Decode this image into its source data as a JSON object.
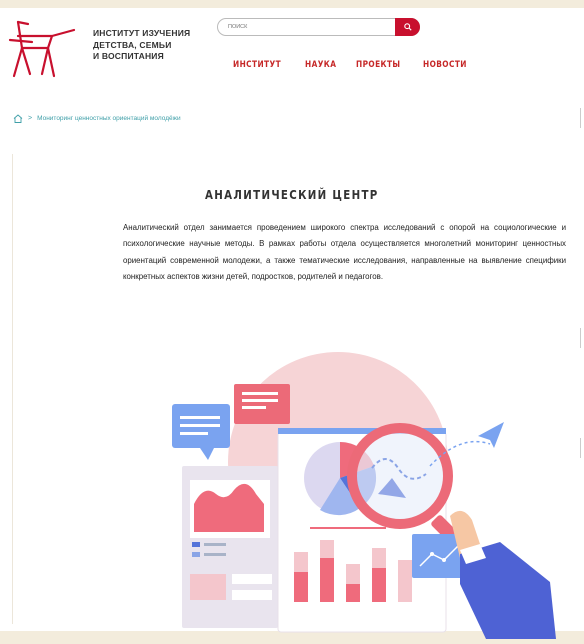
{
  "header": {
    "org_line1": "ИНСТИТУТ ИЗУЧЕНИЯ",
    "org_line2": "ДЕТСТВА, СЕМЬИ",
    "org_line3": "И ВОСПИТАНИЯ",
    "logo_icon": "chair-logo-icon",
    "search_placeholder": "ПОИСК",
    "search_icon": "search-icon"
  },
  "nav": {
    "items": [
      {
        "label": "ИНСТИТУТ"
      },
      {
        "label": "НАУКА"
      },
      {
        "label": "ПРОЕКТЫ"
      },
      {
        "label": "НОВОСТИ"
      }
    ]
  },
  "breadcrumb": {
    "home_icon": "home-icon",
    "separator": ">",
    "current": "Мониторинг ценностных ориентаций молодёжи"
  },
  "main": {
    "title": "АНАЛИТИЧЕСКИЙ ЦЕНТР",
    "description": "Аналитический отдел занимается проведением широкого спектра исследований с опорой на социологические и психологические научные методы. В рамках работы отдела осуществляется многолетний мониторинг ценностных ориентаций современной молодежи, а также тематические исследования, направленные на выявление специфики конкретных аспектов жизни детей, подростков, родителей и педагогов."
  },
  "colors": {
    "brand_red": "#c8102e",
    "nav_red": "#c62828",
    "breadcrumb_teal": "#3f9fa8",
    "illustration_blue": "#6b8fe8",
    "illustration_pink": "#f2c4c8"
  }
}
